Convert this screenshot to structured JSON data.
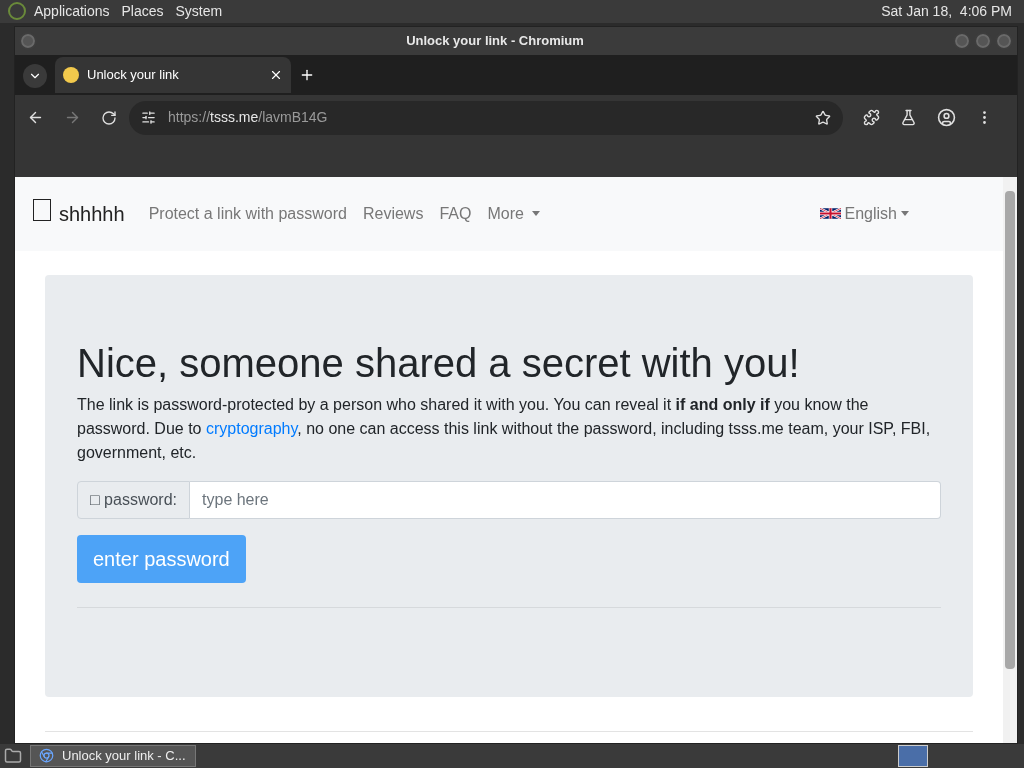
{
  "top_panel": {
    "menus": [
      "Applications",
      "Places",
      "System"
    ],
    "clock": "Sat Jan 18,  4:06 PM"
  },
  "window": {
    "title": "Unlock your link - Chromium"
  },
  "tabs": [
    {
      "label": "Unlock your link",
      "selected": true
    }
  ],
  "address_bar": {
    "scheme": "https://",
    "host": "tsss.me",
    "path": "/lavmB14G"
  },
  "site": {
    "brand": "shhhhh",
    "nav": [
      {
        "label": "Protect a link with password",
        "kind": "link"
      },
      {
        "label": "Reviews",
        "kind": "link"
      },
      {
        "label": "FAQ",
        "kind": "link"
      },
      {
        "label": "More",
        "kind": "dropdown"
      }
    ],
    "language": "English"
  },
  "content": {
    "heading": "Nice, someone shared a secret with you!",
    "paragraph": [
      "The link is password-protected by a person who shared it with you. You can reveal it **if and only if** you know the password. Due to ",
      "cryptography",
      ", no one can access this link without the password, including tsss.me team, your ISP, FBI, government, etc."
    ],
    "password_label": "□ password:",
    "password_placeholder": "type here",
    "button": "enter password"
  },
  "taskbar": {
    "windows": [
      {
        "label": "Unlock your link - C...",
        "selected": true
      }
    ]
  }
}
